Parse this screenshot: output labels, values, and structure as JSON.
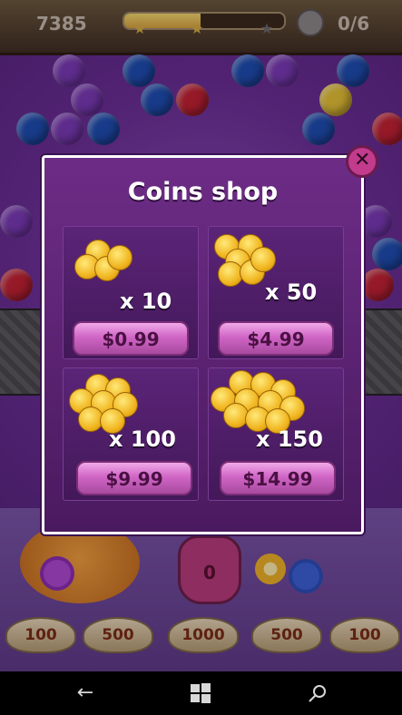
{
  "hud": {
    "score": "7385",
    "progress": 0.48,
    "stars_earned": 2,
    "stars_total": 3,
    "skull_count": "0/6"
  },
  "shop": {
    "title": "Coins shop",
    "close_icon": "close-icon",
    "offers": [
      {
        "quantity": "x 10",
        "price": "$0.99"
      },
      {
        "quantity": "x 50",
        "price": "$4.99"
      },
      {
        "quantity": "x 100",
        "price": "$9.99"
      },
      {
        "quantity": "x 150",
        "price": "$14.99"
      }
    ]
  },
  "pot": {
    "label": "0"
  },
  "score_slots": [
    "100",
    "500",
    "1000",
    "500",
    "100"
  ],
  "navbar": {
    "back_icon": "back-arrow-icon",
    "home_icon": "windows-logo-icon",
    "search_icon": "search-icon"
  },
  "colors": {
    "dialog": "#5b2478",
    "price_button": "#d066c6",
    "coin": "#f0b51f"
  }
}
